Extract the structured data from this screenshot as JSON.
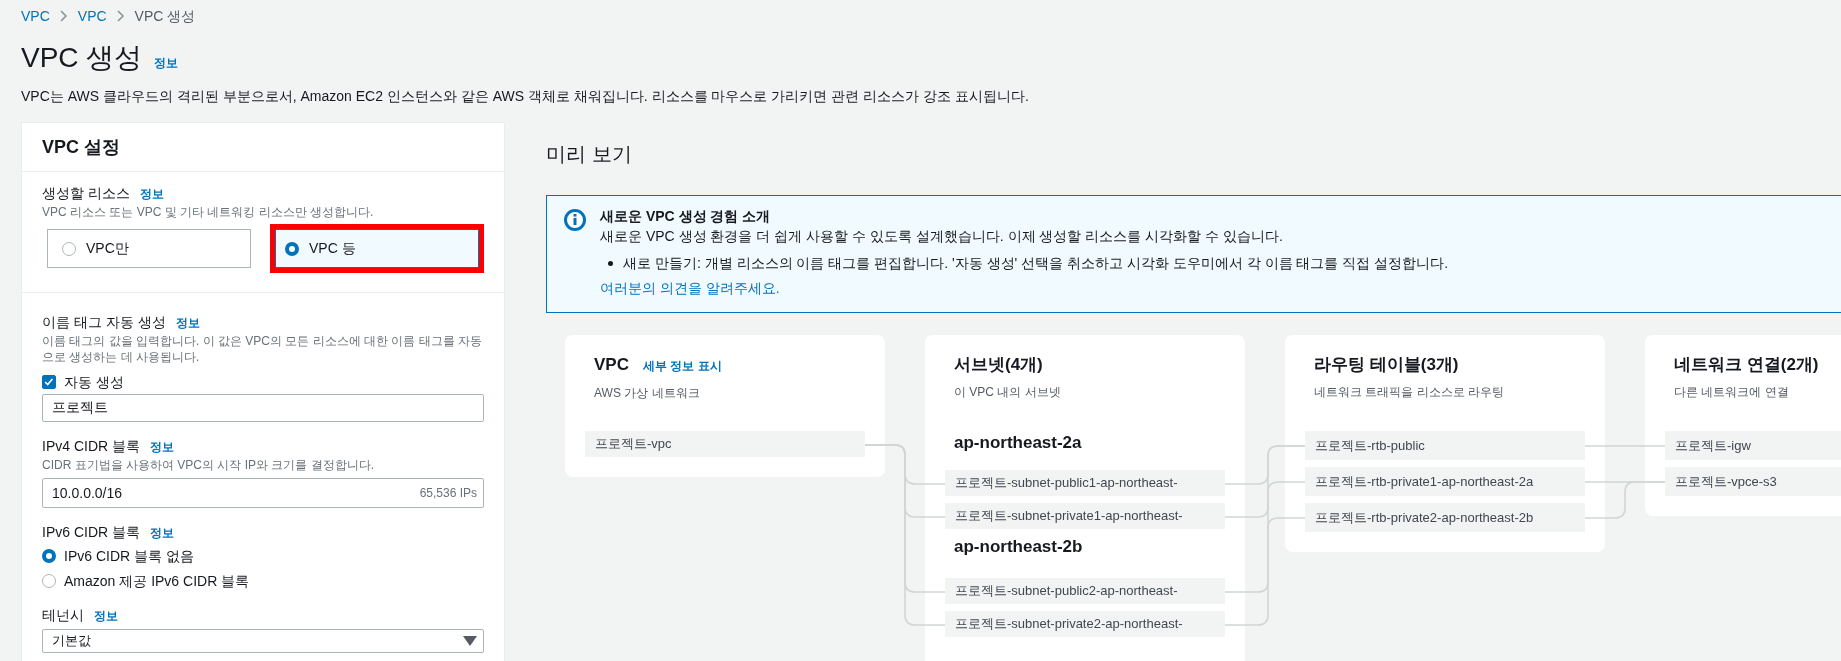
{
  "breadcrumbs": [
    {
      "label": "VPC",
      "current": false
    },
    {
      "label": "VPC",
      "current": false
    },
    {
      "label": "VPC 생성",
      "current": true
    }
  ],
  "page": {
    "title": "VPC 생성",
    "info": "정보",
    "description": "VPC는 AWS 클라우드의 격리된 부분으로서, Amazon EC2 인스턴스와 같은 AWS 객체로 채워집니다. 리소스를 마우스로 가리키면 관련 리소스가 강조 표시됩니다."
  },
  "settings": {
    "title": "VPC 설정",
    "resources": {
      "label": "생성할 리소스",
      "info": "정보",
      "hint": "VPC 리소스 또는 VPC 및 기타 네트워킹 리소스만 생성합니다.",
      "options": [
        {
          "label": "VPC만",
          "selected": false,
          "highlighted": false
        },
        {
          "label": "VPC 등",
          "selected": true,
          "highlighted": true
        }
      ]
    },
    "name_tag": {
      "label": "이름 태그 자동 생성",
      "info": "정보",
      "hint": "이름 태그의 값을 입력합니다. 이 값은 VPC의 모든 리소스에 대한 이름 태그를 자동으로 생성하는 데 사용됩니다.",
      "checkbox": {
        "label": "자동 생성",
        "checked": true
      },
      "value": "프로젝트"
    },
    "ipv4": {
      "label": "IPv4 CIDR 블록",
      "info": "정보",
      "hint": "CIDR 표기법을 사용하여 VPC의 시작 IP와 크기를 결정합니다.",
      "value": "10.0.0.0/16",
      "suffix": "65,536 IPs"
    },
    "ipv6": {
      "label": "IPv6 CIDR 블록",
      "info": "정보",
      "options": [
        {
          "label": "IPv6 CIDR 블록 없음",
          "selected": true
        },
        {
          "label": "Amazon 제공 IPv6 CIDR 블록",
          "selected": false
        }
      ]
    },
    "tenancy": {
      "label": "테넌시",
      "info": "정보",
      "value": "기본값"
    }
  },
  "preview": {
    "title": "미리 보기",
    "notice": {
      "title": "새로운 VPC 생성 경험 소개",
      "text": "새로운 VPC 생성 환경을 더 쉽게 사용할 수 있도록 설계했습니다. 이제 생성할 리소스를 시각화할 수 있습니다.",
      "bullets": [
        "새로 만들기: 개별 리소스의 이름 태그를 편집합니다. '자동 생성' 선택을 취소하고 시각화 도우미에서 각 이름 태그를 직접 설정합니다."
      ],
      "link": "여러분의 의견을 알려주세요."
    },
    "columns": [
      {
        "title": "VPC",
        "link": "세부 정보 표시",
        "subtitle": "AWS 가상 네트워크",
        "groups": [
          {
            "items": [
              "프로젝트-vpc"
            ]
          }
        ]
      },
      {
        "title": "서브넷(4개)",
        "subtitle": "이 VPC 내의 서브넷",
        "groups": [
          {
            "zone": "ap-northeast-2a",
            "items": [
              "프로젝트-subnet-public1-ap-northeast-",
              "프로젝트-subnet-private1-ap-northeast-"
            ]
          },
          {
            "zone": "ap-northeast-2b",
            "items": [
              "프로젝트-subnet-public2-ap-northeast-",
              "프로젝트-subnet-private2-ap-northeast-"
            ]
          }
        ]
      },
      {
        "title": "라우팅 테이블(3개)",
        "subtitle": "네트워크 트래픽을 리소스로 라우팅",
        "groups": [
          {
            "items": [
              "프로젝트-rtb-public",
              "프로젝트-rtb-private1-ap-northeast-2a",
              "프로젝트-rtb-private2-ap-northeast-2b"
            ]
          }
        ]
      },
      {
        "title": "네트워크 연결(2개)",
        "subtitle": "다른 네트워크에 연결",
        "groups": [
          {
            "items": [
              "프로젝트-igw",
              "프로젝트-vpce-s3"
            ]
          }
        ]
      }
    ]
  }
}
